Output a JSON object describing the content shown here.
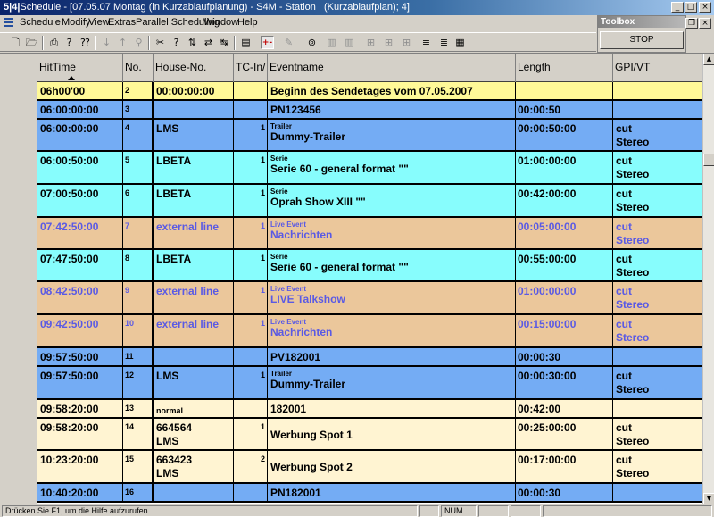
{
  "title": {
    "prefix": "5|4|",
    "text": "Schedule - [07.05.07 Montag (in Kurzablaufplanung) - S4M - Station",
    "suffix": "(Kurzablaufplan); 4]"
  },
  "window_buttons": {
    "minimize": "_",
    "maximize": "□",
    "close": "×"
  },
  "menu": [
    "Schedule",
    "Modify",
    "View",
    "Extras",
    "Parallel Scheduling",
    "Window",
    "Help"
  ],
  "toolbox": {
    "title": "Toolbox",
    "stop": "STOP"
  },
  "toolbar_glyphs": {
    "plus_minus": "+-"
  },
  "columns": [
    "HitTime",
    "No.",
    "House-No.",
    "TC-In/",
    "Eventname",
    "Length",
    "GPI/VT"
  ],
  "rows": [
    {
      "time": "06h00'00",
      "no": "2",
      "house": "00:00:00:00",
      "house2": "",
      "tc": "",
      "type": "",
      "event": "Beginn des Sendetages vom 07.05.2007",
      "length": "",
      "gpi1": "",
      "gpi2": "",
      "color": "yellow"
    },
    {
      "time": "06:00:00:00",
      "no": "3",
      "house": "",
      "house2": "",
      "tc": "",
      "type": "",
      "event": "PN123456",
      "length": "00:00:50",
      "gpi1": "",
      "gpi2": "",
      "color": "blue"
    },
    {
      "time": "06:00:00:00",
      "no": "4",
      "house": "LMS",
      "house2": "",
      "tc": "1",
      "type": "Trailer",
      "event": "Dummy-Trailer",
      "length": "00:00:50:00",
      "gpi1": "cut",
      "gpi2": "Stereo",
      "color": "blue"
    },
    {
      "time": "06:00:50:00",
      "no": "5",
      "house": "LBETA",
      "house2": "",
      "tc": "1",
      "type": "Serie",
      "event": "Serie 60 - general format \"\"",
      "length": "01:00:00:00",
      "gpi1": "cut",
      "gpi2": "Stereo",
      "color": "cyan"
    },
    {
      "time": "07:00:50:00",
      "no": "6",
      "house": "LBETA",
      "house2": "",
      "tc": "1",
      "type": "Serie",
      "event": "Oprah Show XIII \"\"",
      "length": "00:42:00:00",
      "gpi1": "cut",
      "gpi2": "Stereo",
      "color": "cyan"
    },
    {
      "time": "07:42:50:00",
      "no": "7",
      "house": "external line",
      "house2": "",
      "tc": "1",
      "type": "Live Event",
      "event": "Nachrichten",
      "length": "00:05:00:00",
      "gpi1": "cut",
      "gpi2": "Stereo",
      "color": "orange"
    },
    {
      "time": "07:47:50:00",
      "no": "8",
      "house": "LBETA",
      "house2": "",
      "tc": "1",
      "type": "Serie",
      "event": "Serie 60 - general format \"\"",
      "length": "00:55:00:00",
      "gpi1": "cut",
      "gpi2": "Stereo",
      "color": "cyan"
    },
    {
      "time": "08:42:50:00",
      "no": "9",
      "house": "external line",
      "house2": "",
      "tc": "1",
      "type": "Live Event",
      "event": "LIVE Talkshow",
      "length": "01:00:00:00",
      "gpi1": "cut",
      "gpi2": "Stereo",
      "color": "orange"
    },
    {
      "time": "09:42:50:00",
      "no": "10",
      "house": "external line",
      "house2": "",
      "tc": "1",
      "type": "Live Event",
      "event": "Nachrichten",
      "length": "00:15:00:00",
      "gpi1": "cut",
      "gpi2": "Stereo",
      "color": "orange"
    },
    {
      "time": "09:57:50:00",
      "no": "11",
      "house": "",
      "house2": "",
      "tc": "",
      "type": "",
      "event": "PV182001",
      "length": "00:00:30",
      "gpi1": "",
      "gpi2": "",
      "color": "blue"
    },
    {
      "time": "09:57:50:00",
      "no": "12",
      "house": "LMS",
      "house2": "",
      "tc": "1",
      "type": "Trailer",
      "event": "Dummy-Trailer",
      "length": "00:00:30:00",
      "gpi1": "cut",
      "gpi2": "Stereo",
      "color": "blue"
    },
    {
      "time": "09:58:20:00",
      "no": "13",
      "house": "normal",
      "house2": "",
      "tc": "",
      "type": "",
      "event": "182001",
      "length": "00:42:00",
      "gpi1": "",
      "gpi2": "",
      "color": "cream"
    },
    {
      "time": "09:58:20:00",
      "no": "14",
      "house": "664564",
      "house2": "LMS",
      "tc": "1",
      "type": "",
      "event": "Werbung Spot 1",
      "length": "00:25:00:00",
      "gpi1": "cut",
      "gpi2": "Stereo",
      "color": "cream"
    },
    {
      "time": "10:23:20:00",
      "no": "15",
      "house": "663423",
      "house2": "LMS",
      "tc": "2",
      "type": "",
      "event": "Werbung Spot 2",
      "length": "00:17:00:00",
      "gpi1": "cut",
      "gpi2": "Stereo",
      "color": "cream"
    },
    {
      "time": "10:40:20:00",
      "no": "16",
      "house": "",
      "house2": "",
      "tc": "",
      "type": "",
      "event": "PN182001",
      "length": "00:00:30",
      "gpi1": "",
      "gpi2": "",
      "color": "blue"
    }
  ],
  "status": {
    "hint": "Drücken Sie F1, um die Hilfe aufzurufen",
    "num": "NUM"
  }
}
